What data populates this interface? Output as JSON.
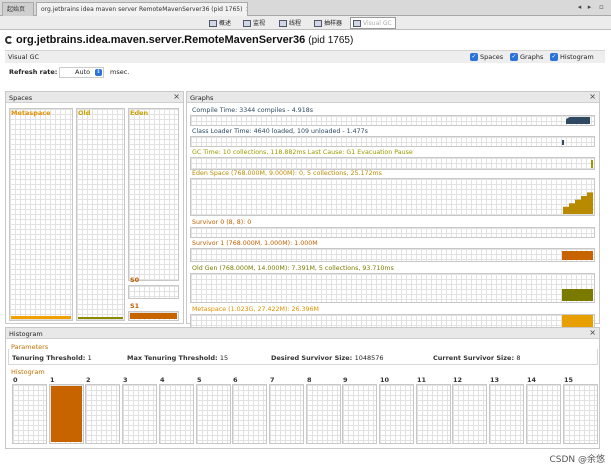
{
  "tabs": [
    {
      "label": "起始页"
    },
    {
      "label": "org.jetbrains idea maven server RemoteMavenServer36 (pid 1765)"
    }
  ],
  "toolbar": [
    {
      "label": "概述"
    },
    {
      "label": "监视"
    },
    {
      "label": "线程"
    },
    {
      "label": "抽样器"
    },
    {
      "label": "Visual GC"
    }
  ],
  "main_title": "org.jetbrains.idea.maven.server.RemoteMavenServer36",
  "main_pid": "(pid 1765)",
  "vgc_label": "Visual GC",
  "view_options": [
    {
      "label": "Spaces",
      "checked": true
    },
    {
      "label": "Graphs",
      "checked": true
    },
    {
      "label": "Histogram",
      "checked": true
    }
  ],
  "refresh": {
    "label": "Refresh rate:",
    "value": "Auto",
    "unit": "msec."
  },
  "spaces": {
    "title": "Spaces",
    "metaspace_label": "Metaspace",
    "old_label": "Old",
    "eden_label": "Eden",
    "s0_label": "S0",
    "s1_label": "S1"
  },
  "graphs": {
    "title": "Graphs",
    "items": [
      {
        "label": "Compile Time: 3344 compiles - 4.918s",
        "color": "#2e4a62"
      },
      {
        "label": "Class Loader Time: 4640 loaded, 109 unloaded - 1.477s",
        "color": "#2e4a62"
      },
      {
        "label": "GC Time: 10 collections, 118.882ms Last Cause: G1 Evacuation Pause",
        "color": "#9a9a00"
      },
      {
        "label": "Eden Space (768.000M, 9.000M): 0, 5 collections, 25.172ms",
        "color": "#b88a00"
      },
      {
        "label": "Survivor 0 (8, 8): 0",
        "color": "#c06000"
      },
      {
        "label": "Survivor 1 (768.000M, 1.000M): 1.000M",
        "color": "#c06000"
      },
      {
        "label": "Old Gen (768.000M, 14.000M): 7.391M, 5 collections, 93.710ms",
        "color": "#7a7a00"
      },
      {
        "label": "Metaspace (1.023G, 27.422M): 26.396M",
        "color": "#e09000"
      }
    ]
  },
  "histogram": {
    "title": "Histogram",
    "params_label": "Parameters",
    "tenuring_threshold_label": "Tenuring Threshold:",
    "tenuring_threshold": "1",
    "max_tenuring_label": "Max Tenuring Threshold:",
    "max_tenuring": "15",
    "desired_survivor_label": "Desired Survivor Size:",
    "desired_survivor": "1048576",
    "current_survivor_label": "Current Survivor Size:",
    "current_survivor": "8",
    "hist_label": "Histogram",
    "bins": [
      "0",
      "1",
      "2",
      "3",
      "4",
      "5",
      "6",
      "7",
      "8",
      "9",
      "10",
      "11",
      "12",
      "13",
      "14",
      "15"
    ],
    "bin_fill": [
      0,
      1,
      0,
      0,
      0,
      0,
      0,
      0,
      0,
      0,
      0,
      0,
      0,
      0,
      0,
      0
    ]
  },
  "watermark": "CSDN @余悠",
  "colors": {
    "accent": "#2b73d6",
    "fill_orange": "#c86400"
  }
}
